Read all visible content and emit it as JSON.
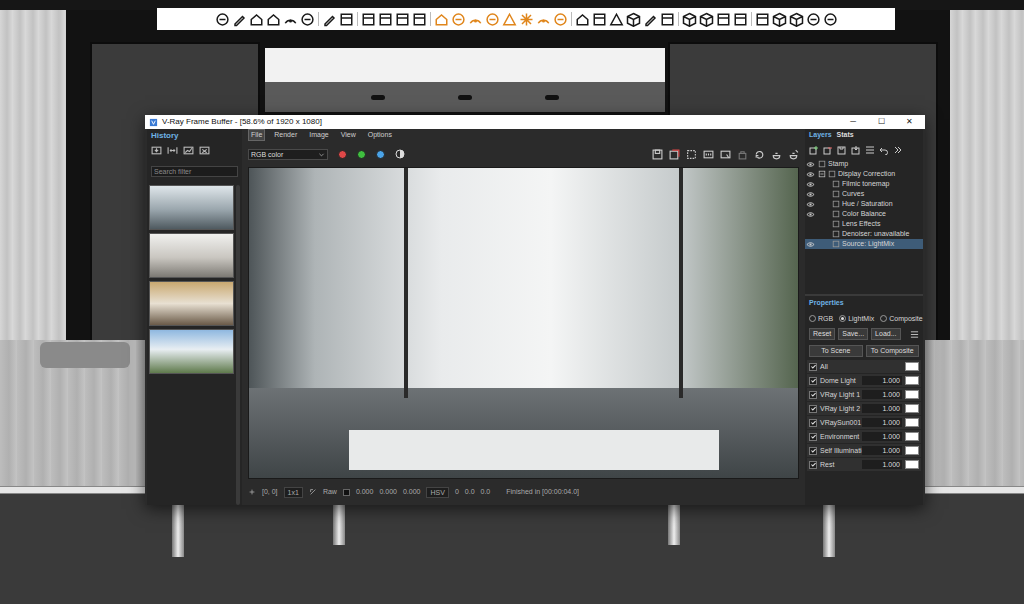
{
  "window": {
    "title": "V-Ray Frame Buffer - [58.6% of 1920 x 1080]",
    "controls": [
      "─",
      "☐",
      "✕"
    ]
  },
  "history": {
    "title": "History",
    "search": {
      "placeholder": "Search filter"
    }
  },
  "menu": [
    {
      "label": "File",
      "selected": true
    },
    {
      "label": "Render",
      "selected": false
    },
    {
      "label": "Image",
      "selected": false
    },
    {
      "label": "View",
      "selected": false
    },
    {
      "label": "Options",
      "selected": false
    }
  ],
  "channel": {
    "value": "RGB color",
    "toggles": [
      {
        "color": "#e04848"
      },
      {
        "color": "#3fbf3f"
      },
      {
        "color": "#4aa3e8"
      }
    ]
  },
  "status_bar": {
    "coords": "[0, 0]",
    "zoom": "1x1",
    "raw": "Raw",
    "rgb": [
      "0.000",
      "0.000",
      "0.000"
    ],
    "mode": "HSV",
    "hsv": [
      "0",
      "0.0",
      "0.0"
    ],
    "message": "Finished in [00:00:04.0]"
  },
  "layers": {
    "tabs": [
      {
        "label": "Layers",
        "selected": true
      },
      {
        "label": "Stats",
        "selected": false
      }
    ],
    "tree": [
      {
        "label": "Stamp",
        "visible": true,
        "selected": false
      },
      {
        "label": "Display Correction",
        "visible": true,
        "selected": false,
        "expanded": true,
        "children": [
          {
            "label": "Filmic tonemap",
            "visible": true,
            "selected": false
          },
          {
            "label": "Curves",
            "visible": true,
            "selected": false
          },
          {
            "label": "Hue / Saturation",
            "visible": true,
            "selected": false
          },
          {
            "label": "Color Balance",
            "visible": true,
            "selected": false
          },
          {
            "label": "Lens Effects",
            "visible": false,
            "selected": false
          },
          {
            "label": "Denoiser: unavailable",
            "visible": false,
            "selected": false
          },
          {
            "label": "Source: LightMix",
            "visible": true,
            "selected": true
          }
        ]
      }
    ]
  },
  "properties": {
    "title": "Properties",
    "modes": [
      {
        "label": "RGB",
        "selected": false
      },
      {
        "label": "LightMix",
        "selected": true
      },
      {
        "label": "Composite",
        "selected": false
      }
    ],
    "buttons": [
      "Reset",
      "Save...",
      "Load..."
    ],
    "actions": [
      "To Scene",
      "To Composite"
    ],
    "lights": [
      {
        "name": "All",
        "checked": true
      },
      {
        "name": "Dome Light",
        "checked": true,
        "value": "1.000"
      },
      {
        "name": "VRay Light 1",
        "checked": true,
        "value": "1.000"
      },
      {
        "name": "VRay Light 2",
        "checked": true,
        "value": "1.000"
      },
      {
        "name": "VRaySun001",
        "checked": true,
        "value": "1.000"
      },
      {
        "name": "Environment",
        "checked": true,
        "value": "1.000"
      },
      {
        "name": "Self Illumination",
        "checked": true,
        "value": "1.000"
      },
      {
        "name": "Rest",
        "checked": true,
        "value": "1.000"
      }
    ]
  }
}
